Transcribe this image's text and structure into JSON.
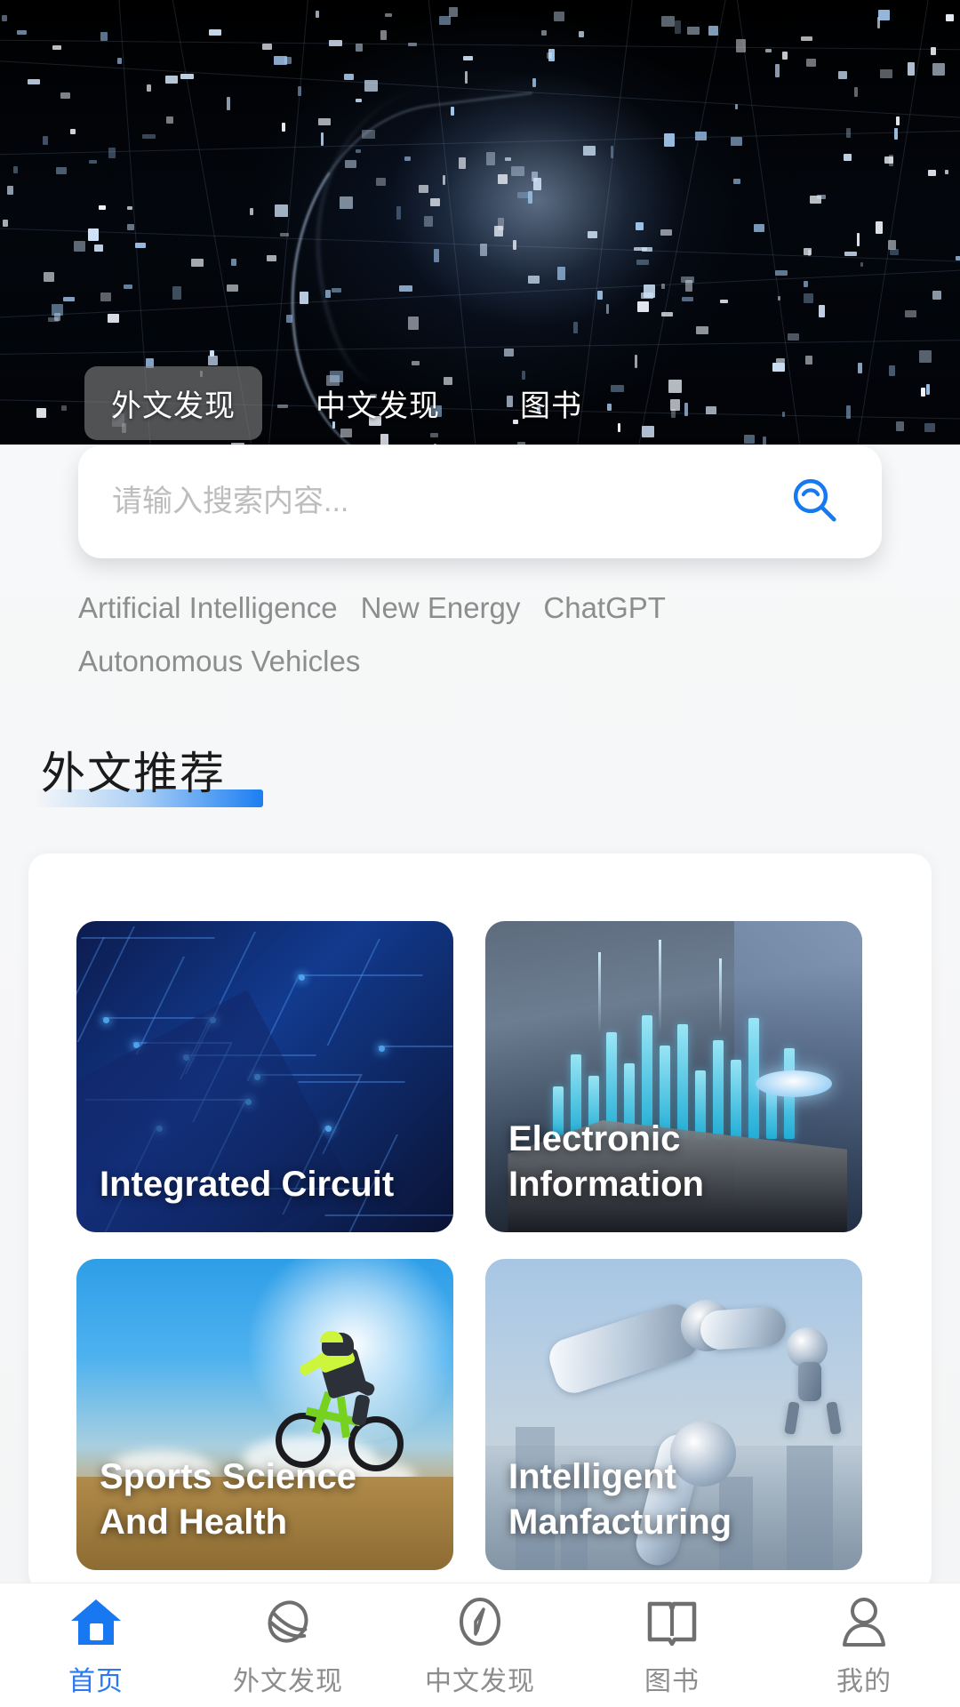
{
  "hero": {
    "alt": "digital data network banner"
  },
  "top_tabs": [
    {
      "label": "外文发现",
      "active": true
    },
    {
      "label": "中文发现",
      "active": false
    },
    {
      "label": "图书",
      "active": false
    }
  ],
  "search": {
    "value": "",
    "placeholder": "请输入搜索内容...",
    "button_icon": "search-icon"
  },
  "keywords": [
    "Artificial Intelligence",
    "New Energy",
    "ChatGPT",
    "Autonomous Vehicles"
  ],
  "section": {
    "title": "外文推荐",
    "underline_color": "#1b7ef2"
  },
  "cards": [
    {
      "label": "Integrated Circuit",
      "theme": "circuit"
    },
    {
      "label": "Electronic\nInformation",
      "theme": "data"
    },
    {
      "label": "Sports Science And\nHealth",
      "theme": "sports"
    },
    {
      "label": "Intelligent\nManfacturing",
      "theme": "robot"
    }
  ],
  "bottom_nav": [
    {
      "label": "首页",
      "icon": "home-icon",
      "active": true
    },
    {
      "label": "外文发现",
      "icon": "planet-icon",
      "active": false
    },
    {
      "label": "中文发现",
      "icon": "compass-icon",
      "active": false
    },
    {
      "label": "图书",
      "icon": "book-icon",
      "active": false
    },
    {
      "label": "我的",
      "icon": "person-icon",
      "active": false
    }
  ],
  "colors": {
    "accent": "#2979f0",
    "nav_inactive": "#8d8d8d",
    "page_bg": "#f5f6f7"
  }
}
